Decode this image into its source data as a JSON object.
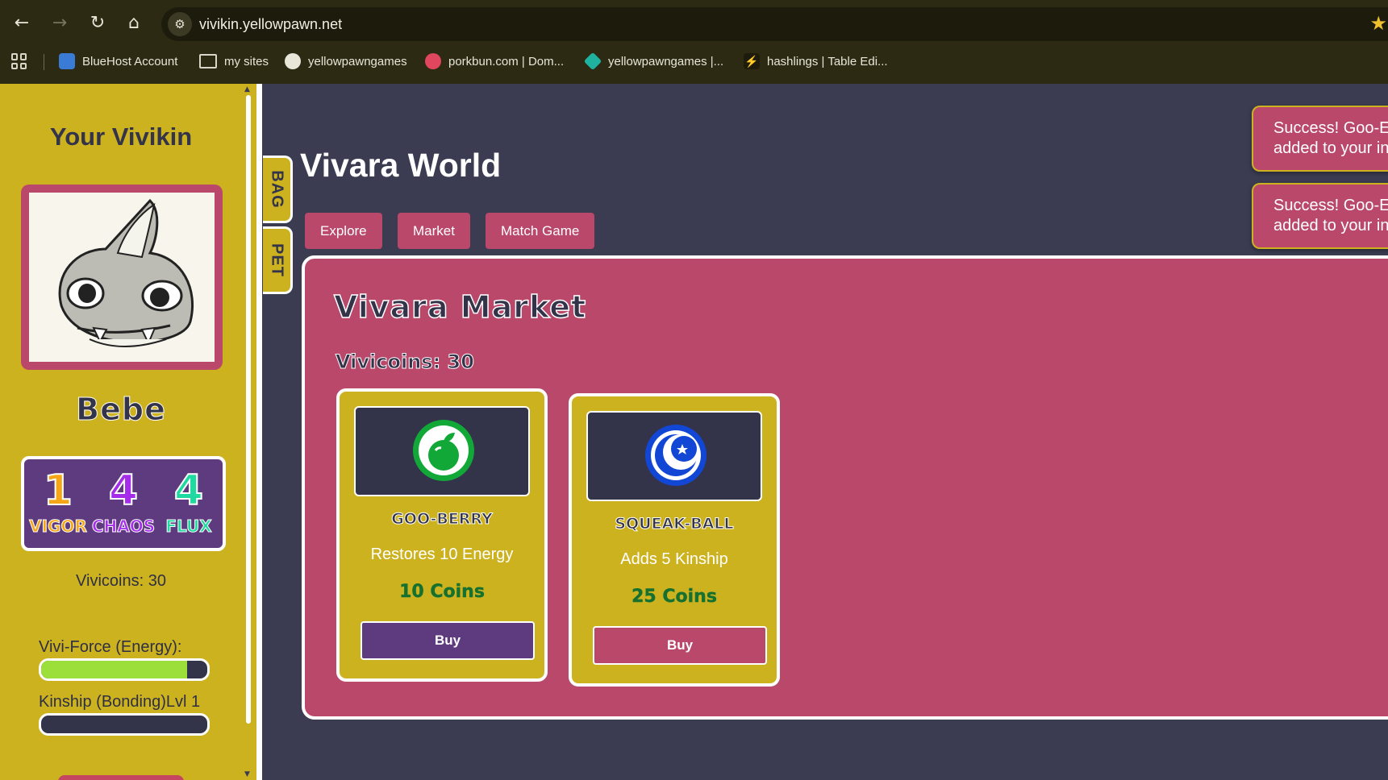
{
  "browser": {
    "url": "vivikin.yellowpawn.net",
    "bookmarks": [
      {
        "label": "BlueHost Account",
        "icon": "grid-icon",
        "color": "#3a7bd5"
      },
      {
        "label": "my sites",
        "icon": "folder-icon",
        "color": "#d8d6c8"
      },
      {
        "label": "yellowpawngames",
        "icon": "github-icon",
        "color": "#e8e6d8"
      },
      {
        "label": "porkbun.com | Dom...",
        "icon": "porkbun-icon",
        "color": "#e0465e"
      },
      {
        "label": "yellowpawngames |...",
        "icon": "diamond-icon",
        "color": "#20b2a0"
      },
      {
        "label": "hashlings | Table Edi...",
        "icon": "bolt-icon",
        "color": "#2ecc71"
      }
    ]
  },
  "sidebar": {
    "title": "Your Vivikin",
    "pet_name": "Bebe",
    "stats": [
      {
        "value": "1",
        "label": "VIGOR",
        "color": "#f5a516"
      },
      {
        "value": "4",
        "label": "CHAOS",
        "color": "#a52dea"
      },
      {
        "value": "4",
        "label": "FLUX",
        "color": "#1fd9a0"
      }
    ],
    "coins": "Vivicoins: 30",
    "energy_label": "Vivi-Force (Energy):",
    "energy_fraction": 0.88,
    "kinship_label": "Kinship (Bonding)Lvl 1",
    "kinship_fraction": 0
  },
  "tabs": {
    "bag": "BAG",
    "pet": "PET"
  },
  "main": {
    "title": "Vivara World",
    "nav": [
      "Explore",
      "Market",
      "Match Game"
    ]
  },
  "market": {
    "title": "Vivara Market",
    "coins": "Vivicoins: 30",
    "items": [
      {
        "name": "GOO-BERRY",
        "description": "Restores 10 Energy",
        "price": "10 Coins",
        "buy_label": "Buy",
        "icon": "apple-icon",
        "buy_color": "#5e3b7e"
      },
      {
        "name": "SQUEAK-BALL",
        "description": "Adds 5 Kinship",
        "price": "25 Coins",
        "buy_label": "Buy",
        "icon": "moon-ball-icon",
        "buy_color": "#b9486a"
      }
    ]
  },
  "toasts": [
    {
      "line1": "Success! Goo-E",
      "line2": "added to your in"
    },
    {
      "line1": "Success! Goo-E",
      "line2": "added to your in"
    }
  ],
  "colors": {
    "panel_yellow": "#cdb220",
    "market_pink": "#b9486a",
    "page_bg": "#3b3b52",
    "energy_green": "#9ddf3a"
  }
}
